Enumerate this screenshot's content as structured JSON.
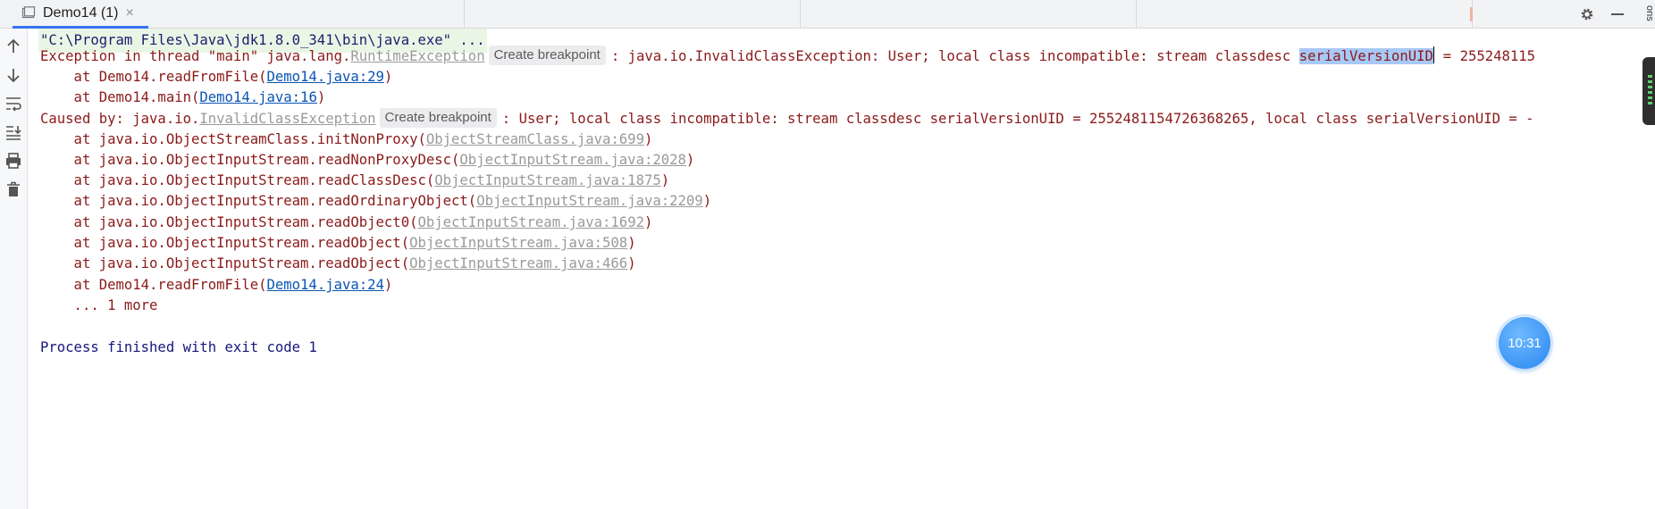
{
  "tab": {
    "label": "Demo14 (1)",
    "close": "×"
  },
  "side_label": "ons",
  "toolbar_icons": [
    "rerun-up-icon",
    "down-arrow-icon",
    "soft-wrap-icon",
    "scroll-to-end-icon",
    "print-icon",
    "trash-icon"
  ],
  "console": {
    "command": "\"C:\\Program Files\\Java\\jdk1.8.0_341\\bin\\java.exe\" ...",
    "breakpoint_label": "Create breakpoint",
    "exception_prefix": "Exception in thread \"main\" java.lang.",
    "exception_class": "RuntimeException",
    "exception_msg_pre": ": java.io.InvalidClassException: User; local class incompatible: stream classdesc ",
    "exception_selected": "serialVersionUID",
    "exception_msg_post": " = 255248115",
    "frames_top": [
      {
        "prefix": "    at Demo14.readFromFile(",
        "link": "Demo14.java:29",
        "suffix": ")"
      },
      {
        "prefix": "    at Demo14.main(",
        "link": "Demo14.java:16",
        "suffix": ")"
      }
    ],
    "caused_prefix": "Caused by: java.io.",
    "caused_class": "InvalidClassException",
    "caused_msg": ": User; local class incompatible: stream classdesc serialVersionUID = 2552481154726368265, local class serialVersionUID = -",
    "frames_cause": [
      {
        "prefix": "    at java.io.ObjectStreamClass.initNonProxy(",
        "link": "ObjectStreamClass.java:699",
        "suffix": ")",
        "style": "gray"
      },
      {
        "prefix": "    at java.io.ObjectInputStream.readNonProxyDesc(",
        "link": "ObjectInputStream.java:2028",
        "suffix": ")",
        "style": "gray"
      },
      {
        "prefix": "    at java.io.ObjectInputStream.readClassDesc(",
        "link": "ObjectInputStream.java:1875",
        "suffix": ")",
        "style": "gray"
      },
      {
        "prefix": "    at java.io.ObjectInputStream.readOrdinaryObject(",
        "link": "ObjectInputStream.java:2209",
        "suffix": ")",
        "style": "gray"
      },
      {
        "prefix": "    at java.io.ObjectInputStream.readObject0(",
        "link": "ObjectInputStream.java:1692",
        "suffix": ")",
        "style": "gray"
      },
      {
        "prefix": "    at java.io.ObjectInputStream.readObject(",
        "link": "ObjectInputStream.java:508",
        "suffix": ")",
        "style": "gray"
      },
      {
        "prefix": "    at java.io.ObjectInputStream.readObject(",
        "link": "ObjectInputStream.java:466",
        "suffix": ")",
        "style": "gray"
      },
      {
        "prefix": "    at Demo14.readFromFile(",
        "link": "Demo14.java:24",
        "suffix": ")",
        "style": "blue"
      }
    ],
    "more": "    ... 1 more",
    "exit": "Process finished with exit code 1"
  },
  "clock": {
    "time": "10:31"
  },
  "colors": {
    "error_text": "#8b1a1a",
    "link_blue": "#0a54b4",
    "link_gray": "#9a9a9a",
    "accent": "#3574f0",
    "clock_blue": "#2787f0"
  }
}
